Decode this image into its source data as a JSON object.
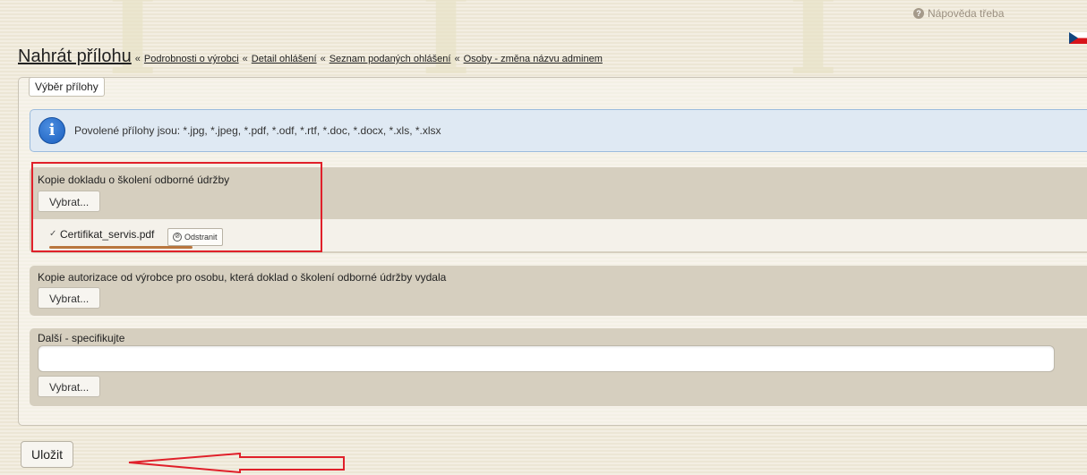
{
  "help": {
    "label": "Nápověda třeba",
    "icon": "question-icon"
  },
  "language": {
    "icon": "czech-flag-icon"
  },
  "header": {
    "title": "Nahrát přílohu",
    "separator": "«",
    "breadcrumbs": [
      "Podrobnosti o výrobci",
      "Detail ohlášení",
      "Seznam podaných ohlášení",
      "Osoby - změna názvu adminem"
    ]
  },
  "form": {
    "legend": "Výběr přílohy",
    "info": {
      "icon": "info-icon",
      "text": "Povolené přílohy jsou: *.jpg, *.jpeg, *.pdf, *.odf, *.rtf, *.doc, *.docx, *.xls, *.xlsx"
    },
    "sections": [
      {
        "label": "Kopie dokladu o školení odborné údržby",
        "button": "Vybrat...",
        "file": {
          "check": "✓",
          "name": "Certifikat_servis.pdf",
          "remove_label": "Odstranit",
          "remove_icon": "⊘"
        }
      },
      {
        "label": "Kopie autorizace od výrobce pro osobu, která doklad o školení odborné údržby vydala",
        "button": "Vybrat..."
      },
      {
        "label": "Další - specifikujte",
        "input_value": "",
        "button": "Vybrat..."
      }
    ]
  },
  "footer": {
    "save_label": "Uložit"
  },
  "colors": {
    "highlight": "#e0202a",
    "info_bg": "#dfe9f3",
    "section_bg": "#d6cfbf"
  }
}
